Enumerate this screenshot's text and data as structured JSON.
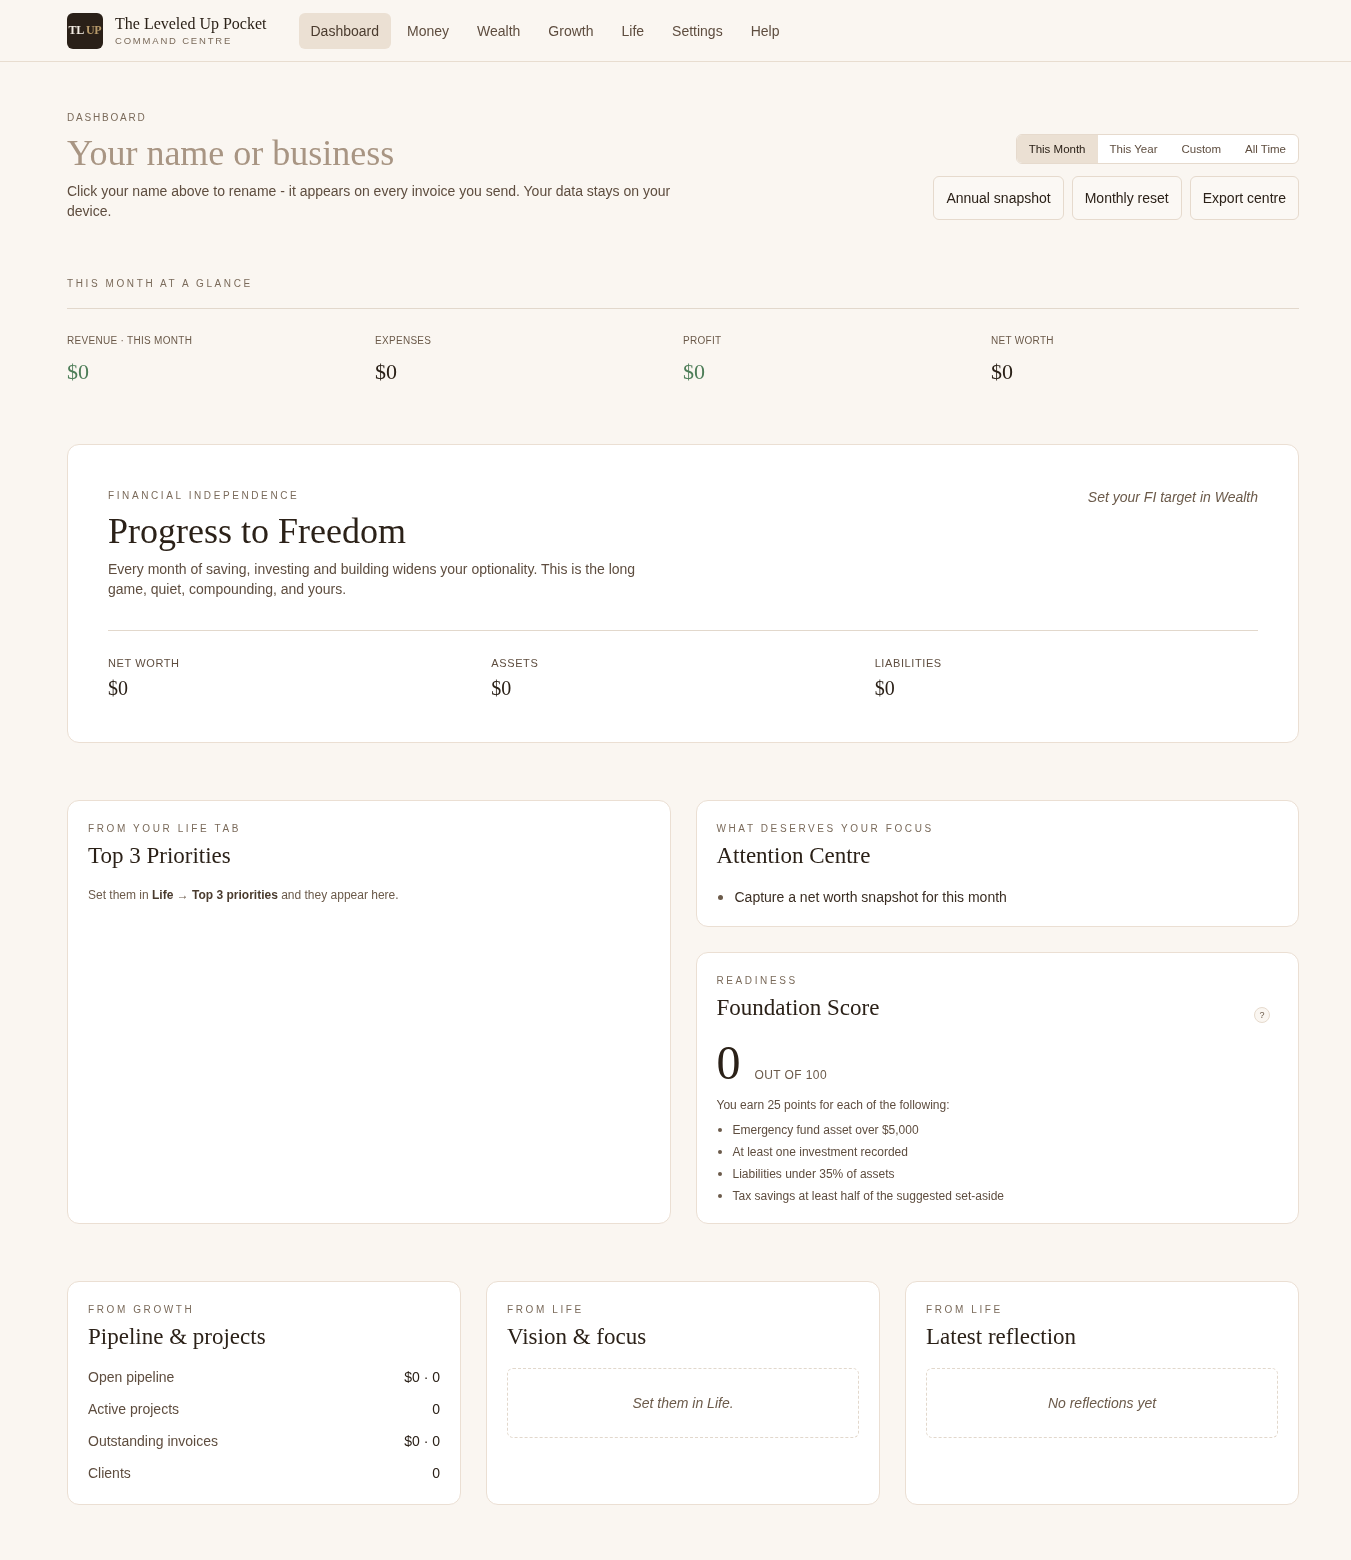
{
  "header": {
    "logo": {
      "text": "TL",
      "accent": "UP"
    },
    "brand_name": "The Leveled Up Pocket",
    "brand_tagline": "COMMAND CENTRE"
  },
  "nav": [
    {
      "label": "Dashboard",
      "selected": true
    },
    {
      "label": "Money",
      "selected": false
    },
    {
      "label": "Wealth",
      "selected": false
    },
    {
      "label": "Growth",
      "selected": false
    },
    {
      "label": "Life",
      "selected": false
    },
    {
      "label": "Settings",
      "selected": false
    },
    {
      "label": "Help",
      "selected": false
    }
  ],
  "page": {
    "eyebrow": "DASHBOARD",
    "name": {
      "placeholder": "Your name or business"
    },
    "description": "Click your name above to rename - it appears on every invoice you send. Your data stays on your device.",
    "periods": [
      {
        "label": "This Month",
        "selected": true
      },
      {
        "label": "This Year",
        "selected": false
      },
      {
        "label": "Custom",
        "selected": false
      },
      {
        "label": "All Time",
        "selected": false
      }
    ],
    "actions": [
      "Annual snapshot",
      "Monthly reset",
      "Export centre"
    ]
  },
  "glance": {
    "title": "THIS MONTH AT A GLANCE",
    "stats": [
      {
        "label": "REVENUE · THIS MONTH",
        "value": "$0",
        "color": "#4d7d58"
      },
      {
        "label": "EXPENSES",
        "value": "$0",
        "color": "#2b2118"
      },
      {
        "label": "PROFIT",
        "value": "$0",
        "color": "#4d7d58"
      },
      {
        "label": "NET WORTH",
        "value": "$0",
        "color": "#2b2118"
      }
    ]
  },
  "fi_card": {
    "eyebrow": "FINANCIAL INDEPENDENCE",
    "title": "Progress to Freedom",
    "description": "Every month of saving, investing and building widens your optionality. This is the long game, quiet, compounding, and yours.",
    "hint": "Set your FI target in Wealth",
    "stats": [
      {
        "label": "NET WORTH",
        "value": "$0"
      },
      {
        "label": "ASSETS",
        "value": "$0"
      },
      {
        "label": "LIABILITIES",
        "value": "$0"
      }
    ]
  },
  "priorities": {
    "eyebrow": "FROM YOUR LIFE TAB",
    "title": "Top 3 Priorities",
    "note": "Set them in **Life** → **Top 3 priorities** and they appear here."
  },
  "attention": {
    "eyebrow": "WHAT DESERVES YOUR FOCUS",
    "title": "Attention Centre",
    "items": [
      "Capture a net worth snapshot for this month"
    ]
  },
  "foundation": {
    "eyebrow": "READINESS",
    "title": "Foundation Score",
    "help": "?",
    "score": "0",
    "score_suffix": "OUT OF 100",
    "intro": "You earn 25 points for each of the following:",
    "criteria": [
      "Emergency fund asset over $5,000",
      "At least one investment recorded",
      "Liabilities under 35% of assets",
      "Tax savings at least half of the suggested set-aside"
    ]
  },
  "bottom_cards": [
    {
      "kind": "list",
      "eyebrow": "FROM GROWTH",
      "title": "Pipeline & projects",
      "rows": [
        {
          "label": "Open pipeline",
          "value": "$0 · 0"
        },
        {
          "label": "Active projects",
          "value": "0"
        },
        {
          "label": "Outstanding invoices",
          "value": "$0 · 0"
        },
        {
          "label": "Clients",
          "value": "0"
        }
      ]
    },
    {
      "kind": "empty",
      "eyebrow": "FROM LIFE",
      "title": "Vision & focus",
      "empty_text": "Set them in Life."
    },
    {
      "kind": "empty",
      "eyebrow": "FROM LIFE",
      "title": "Latest reflection",
      "empty_text": "No reflections yet"
    }
  ]
}
